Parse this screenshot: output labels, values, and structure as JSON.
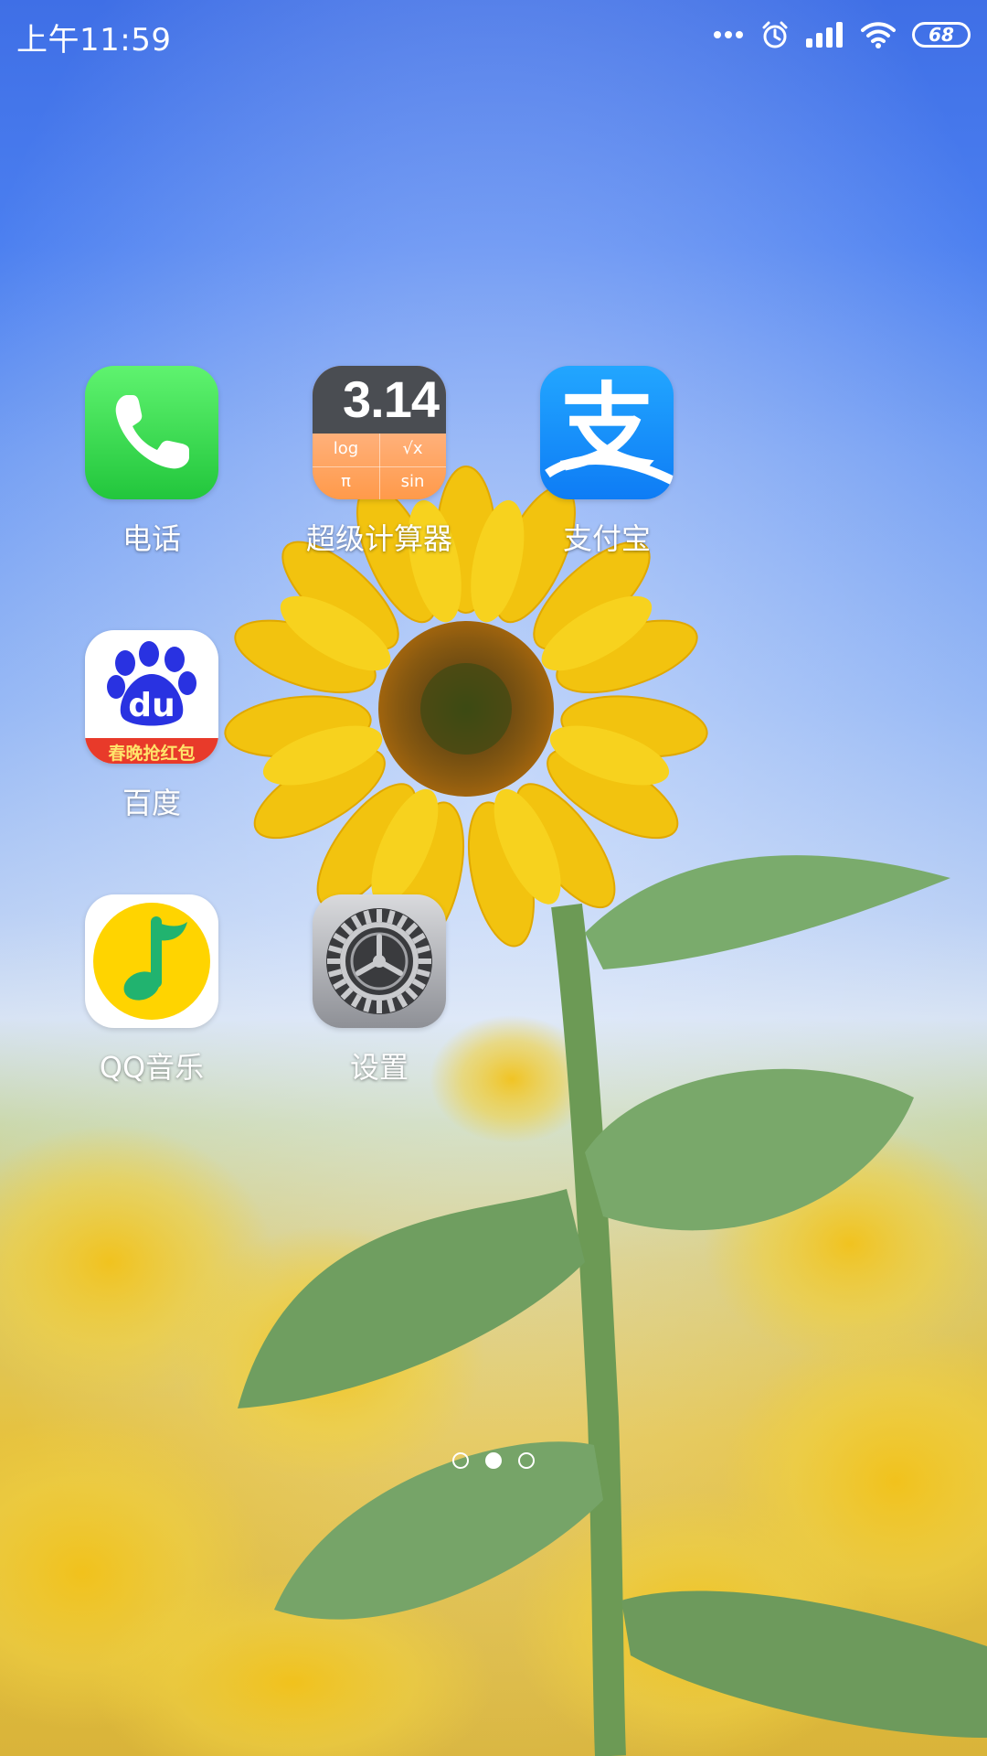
{
  "status_bar": {
    "time": "上午11:59",
    "battery_level": "68",
    "icons": [
      "more-dots-icon",
      "alarm-icon",
      "signal-icon",
      "wifi-icon",
      "battery-icon"
    ]
  },
  "apps": [
    {
      "id": "phone",
      "label": "电话",
      "icon": "phone-icon"
    },
    {
      "id": "calculator",
      "label": "超级计算器",
      "icon": "calculator-icon",
      "icon_text": {
        "value": "3.14",
        "keys": [
          "log",
          "√x",
          "π",
          "sin"
        ]
      }
    },
    {
      "id": "alipay",
      "label": "支付宝",
      "icon": "alipay-icon",
      "icon_text": "支"
    },
    {
      "id": "baidu",
      "label": "百度",
      "icon": "baidu-icon",
      "icon_text": {
        "logo": "du",
        "banner": "春晚抢红包"
      }
    },
    {
      "id": "qqmusic",
      "label": "QQ音乐",
      "icon": "qq-music-icon"
    },
    {
      "id": "settings",
      "label": "设置",
      "icon": "settings-gear-icon"
    }
  ],
  "page_indicator": {
    "count": 3,
    "active": 2
  },
  "colors": {
    "phone_green": "#2fd04a",
    "alipay_blue": "#1677ff",
    "calc_dark": "#4a4d52",
    "calc_orange": "#ff9e55",
    "qq_yellow": "#ffd400",
    "qq_green": "#21b36f",
    "baidu_blue": "#2932e1",
    "baidu_red": "#e83a2a"
  }
}
